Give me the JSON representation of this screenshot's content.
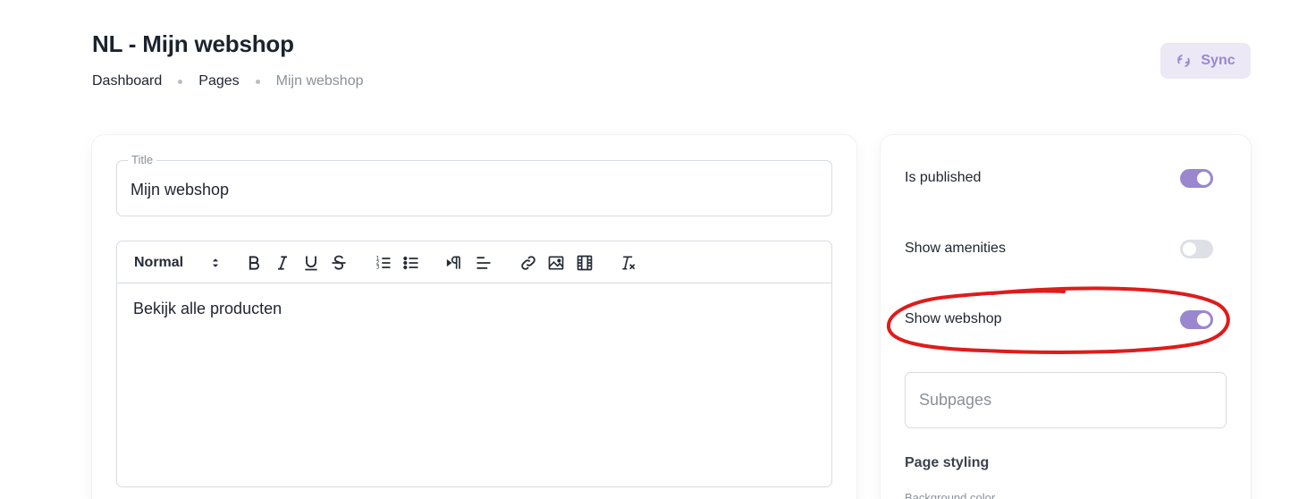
{
  "header": {
    "title": "NL - Mijn webshop",
    "breadcrumbs": [
      "Dashboard",
      "Pages",
      "Mijn webshop"
    ],
    "sync_label": "Sync"
  },
  "form": {
    "title_label": "Title",
    "title_value": "Mijn webshop",
    "editor": {
      "style_select": "Normal",
      "toolbar_icons": [
        "bold-icon",
        "italic-icon",
        "underline-icon",
        "strikethrough-icon",
        "ordered-list-icon",
        "bullet-list-icon",
        "rtl-direction-icon",
        "align-icon",
        "link-icon",
        "image-icon",
        "video-icon",
        "clear-format-icon"
      ],
      "content": "Bekijk alle producten"
    }
  },
  "sidebar": {
    "toggles": [
      {
        "label": "Is published",
        "on": true
      },
      {
        "label": "Show amenities",
        "on": false
      },
      {
        "label": "Show webshop",
        "on": true
      }
    ],
    "subpages_placeholder": "Subpages",
    "page_styling_title": "Page styling",
    "background_color_label": "Background color"
  },
  "colors": {
    "accent": "#9a87cf",
    "annotation": "#e01b1b"
  }
}
